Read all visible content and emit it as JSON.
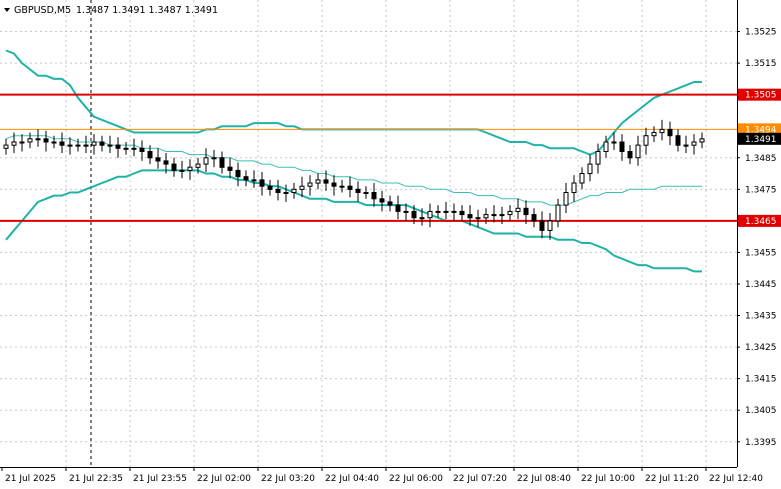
{
  "header": {
    "symbol": "GBPUSD,M5",
    "ohlc": "1.3487 1.3491 1.3487 1.3491"
  },
  "colors": {
    "background": "#ffffff",
    "candle": "#000000",
    "bands": "#1fb3a8",
    "middle": "#3fbfb4",
    "support_resistance": "#e00000",
    "price_line": "#ff8c00",
    "current_tag": "#000000",
    "grid": "#c8c8c8"
  },
  "chart_data": {
    "type": "candlestick",
    "ylim": [
      1.3387,
      1.3535
    ],
    "y_ticks": [
      "1.3525",
      "1.3515",
      "1.3505",
      "1.3494",
      "1.3491",
      "1.3485",
      "1.3475",
      "1.3465",
      "1.3455",
      "1.3445",
      "1.3435",
      "1.3425",
      "1.3415",
      "1.3405",
      "1.3395"
    ],
    "x_ticks": [
      "21 Jul 2025",
      "21 Jul 22:35",
      "21 Jul 23:55",
      "22 Jul 02:00",
      "22 Jul 03:20",
      "22 Jul 04:40",
      "22 Jul 06:00",
      "22 Jul 07:20",
      "22 Jul 08:40",
      "22 Jul 10:00",
      "22 Jul 11:20",
      "22 Jul 12:40"
    ],
    "levels": [
      {
        "price": 1.3505,
        "label": "1.3505",
        "kind": "resistance"
      },
      {
        "price": 1.3465,
        "label": "1.3465",
        "kind": "support"
      }
    ],
    "price_line": {
      "price": 1.3494,
      "label": "1.3494"
    },
    "current_price": {
      "price": 1.3491,
      "label": "1.3491"
    },
    "vline_index": 10,
    "closes": [
      1.3489,
      1.349,
      1.349,
      1.3491,
      1.3491,
      1.349,
      1.349,
      1.3489,
      1.3489,
      1.3489,
      1.3489,
      1.349,
      1.3489,
      1.3489,
      1.3488,
      1.3488,
      1.3488,
      1.3487,
      1.3485,
      1.3484,
      1.3483,
      1.3481,
      1.3481,
      1.3482,
      1.3483,
      1.3485,
      1.3485,
      1.3482,
      1.3481,
      1.3479,
      1.3478,
      1.3478,
      1.3476,
      1.3475,
      1.3474,
      1.3474,
      1.3475,
      1.3476,
      1.3477,
      1.3478,
      1.3477,
      1.3476,
      1.3476,
      1.3475,
      1.3474,
      1.3474,
      1.3472,
      1.3471,
      1.347,
      1.3468,
      1.3468,
      1.3466,
      1.3466,
      1.3468,
      1.3468,
      1.3468,
      1.3468,
      1.3467,
      1.3466,
      1.3466,
      1.3467,
      1.3467,
      1.3467,
      1.3468,
      1.3469,
      1.3467,
      1.3465,
      1.3462,
      1.3465,
      1.347,
      1.3474,
      1.3477,
      1.348,
      1.3483,
      1.3487,
      1.349,
      1.349,
      1.3487,
      1.3485,
      1.3489,
      1.3492,
      1.3493,
      1.3494,
      1.3492,
      1.3489,
      1.3489,
      1.349,
      1.3491
    ],
    "upper_band": [
      1.3519,
      1.3518,
      1.3515,
      1.3513,
      1.3511,
      1.3511,
      1.351,
      1.351,
      1.3508,
      1.3504,
      1.3501,
      1.3498,
      1.3497,
      1.3496,
      1.3495,
      1.3494,
      1.3493,
      1.3493,
      1.3493,
      1.3493,
      1.3493,
      1.3493,
      1.3493,
      1.3493,
      1.3493,
      1.3494,
      1.3494,
      1.3495,
      1.3495,
      1.3495,
      1.3495,
      1.3496,
      1.3496,
      1.3496,
      1.3496,
      1.3495,
      1.3495,
      1.3494,
      1.3494,
      1.3494,
      1.3494,
      1.3494,
      1.3494,
      1.3494,
      1.3494,
      1.3494,
      1.3494,
      1.3494,
      1.3494,
      1.3494,
      1.3494,
      1.3494,
      1.3494,
      1.3494,
      1.3494,
      1.3494,
      1.3494,
      1.3494,
      1.3494,
      1.3494,
      1.3493,
      1.3492,
      1.3491,
      1.349,
      1.349,
      1.349,
      1.3489,
      1.3489,
      1.3488,
      1.3488,
      1.3488,
      1.3488,
      1.3487,
      1.3486,
      1.3487,
      1.349,
      1.3493,
      1.3496,
      1.3498,
      1.35,
      1.3502,
      1.3504,
      1.3505,
      1.3506,
      1.3507,
      1.3508,
      1.3509,
      1.3509
    ],
    "middle_band": [
      1.3491,
      1.3492,
      1.3492,
      1.3492,
      1.3492,
      1.3492,
      1.3491,
      1.3491,
      1.3491,
      1.349,
      1.349,
      1.349,
      1.349,
      1.3489,
      1.3489,
      1.3489,
      1.3489,
      1.3488,
      1.3488,
      1.3488,
      1.3487,
      1.3487,
      1.3487,
      1.3486,
      1.3486,
      1.3486,
      1.3485,
      1.3485,
      1.3485,
      1.3484,
      1.3484,
      1.3484,
      1.3483,
      1.3483,
      1.3482,
      1.3482,
      1.3482,
      1.3481,
      1.3481,
      1.348,
      1.348,
      1.3479,
      1.3479,
      1.3479,
      1.3478,
      1.3478,
      1.3478,
      1.3477,
      1.3477,
      1.3477,
      1.3476,
      1.3476,
      1.3476,
      1.3475,
      1.3475,
      1.3475,
      1.3474,
      1.3474,
      1.3474,
      1.3473,
      1.3473,
      1.3473,
      1.3472,
      1.3472,
      1.3472,
      1.3471,
      1.3471,
      1.3471,
      1.347,
      1.347,
      1.347,
      1.3471,
      1.3472,
      1.3473,
      1.3473,
      1.3474,
      1.3474,
      1.3474,
      1.3475,
      1.3475,
      1.3475,
      1.3475,
      1.3476,
      1.3476,
      1.3476,
      1.3476,
      1.3476,
      1.3476
    ],
    "lower_band": [
      1.3459,
      1.3462,
      1.3465,
      1.3468,
      1.3471,
      1.3472,
      1.3473,
      1.3473,
      1.3474,
      1.3474,
      1.3475,
      1.3476,
      1.3477,
      1.3478,
      1.3479,
      1.3479,
      1.348,
      1.3481,
      1.3481,
      1.3481,
      1.3481,
      1.3481,
      1.3481,
      1.3481,
      1.3481,
      1.348,
      1.348,
      1.3479,
      1.3479,
      1.3478,
      1.3478,
      1.3477,
      1.3477,
      1.3476,
      1.3476,
      1.3475,
      1.3474,
      1.3473,
      1.3472,
      1.3472,
      1.3472,
      1.3471,
      1.3471,
      1.3471,
      1.3471,
      1.347,
      1.347,
      1.347,
      1.347,
      1.347,
      1.347,
      1.3469,
      1.3468,
      1.3467,
      1.3466,
      1.3465,
      1.3465,
      1.3465,
      1.3464,
      1.3463,
      1.3462,
      1.3461,
      1.3461,
      1.3461,
      1.3461,
      1.346,
      1.346,
      1.346,
      1.346,
      1.3459,
      1.3459,
      1.3459,
      1.3458,
      1.3458,
      1.3457,
      1.3456,
      1.3454,
      1.3453,
      1.3452,
      1.3451,
      1.3451,
      1.345,
      1.345,
      1.345,
      1.345,
      1.345,
      1.3449,
      1.3449
    ]
  }
}
